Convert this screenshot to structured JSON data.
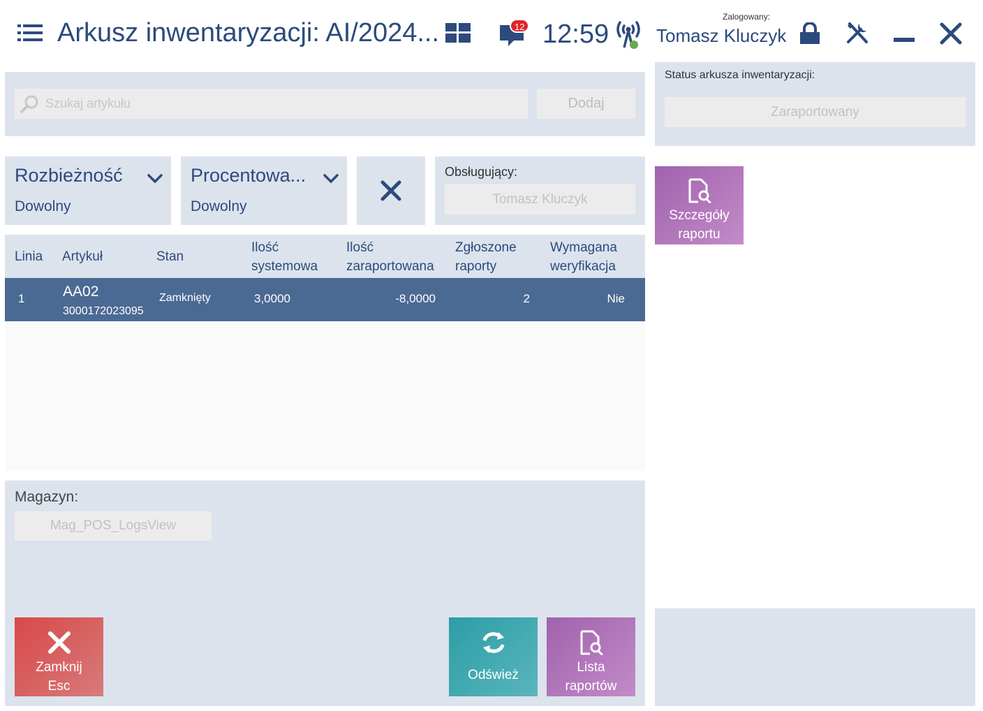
{
  "header": {
    "title": "Arkusz inwentaryzacji: AI/2024...",
    "notification_count": "12",
    "clock": "12:59",
    "logged_in_label": "Zalogowany:",
    "user_name": "Tomasz Kluczyk",
    "icons": [
      "menu-icon",
      "tiles-icon",
      "chat-icon",
      "signal-icon",
      "lock-icon",
      "tools-icon",
      "minimize-icon",
      "close-icon"
    ]
  },
  "search": {
    "placeholder": "Szukaj artykułu",
    "add_label": "Dodaj"
  },
  "status": {
    "label": "Status arkusza inwentaryzacji:",
    "value": "Zaraportowany"
  },
  "filters": {
    "discrepancy": {
      "title": "Rozbieżność",
      "value": "Dowolny"
    },
    "percent": {
      "title": "Procentowa...",
      "value": "Dowolny"
    }
  },
  "operator": {
    "label": "Obsługujący:",
    "value": "Tomasz Kluczyk"
  },
  "table": {
    "columns": {
      "line": "Linia",
      "article": "Artykuł",
      "state": "Stan",
      "system_qty_1": "Ilość",
      "system_qty_2": "systemowa",
      "reported_qty_1": "Ilość",
      "reported_qty_2": "zaraportowana",
      "reports_1": "Zgłoszone",
      "reports_2": "raporty",
      "verification_1": "Wymagana",
      "verification_2": "weryfikacja"
    },
    "rows": [
      {
        "line": "1",
        "article_code": "AA02",
        "article_ean": "3000172023095",
        "state": "Zamknięty",
        "system_qty": "3,0000",
        "reported_qty": "-8,0000",
        "reports": "2",
        "verification": "Nie"
      }
    ]
  },
  "warehouse": {
    "label": "Magazyn:",
    "value": "Mag_POS_LogsView"
  },
  "buttons": {
    "close_line1": "Zamknij",
    "close_line2": "Esc",
    "refresh": "Odśwież",
    "reports_list_line1": "Lista",
    "reports_list_line2": "raportów",
    "report_details_line1": "Szczegóły",
    "report_details_line2": "raportu"
  },
  "colors": {
    "accent": "#2c4a7c",
    "selected_row": "#4b6a93",
    "panel": "#dce3ed",
    "close": "#d94848",
    "refresh": "#2c9ea6",
    "purple": "#a062ad",
    "badge": "#e0232b"
  }
}
